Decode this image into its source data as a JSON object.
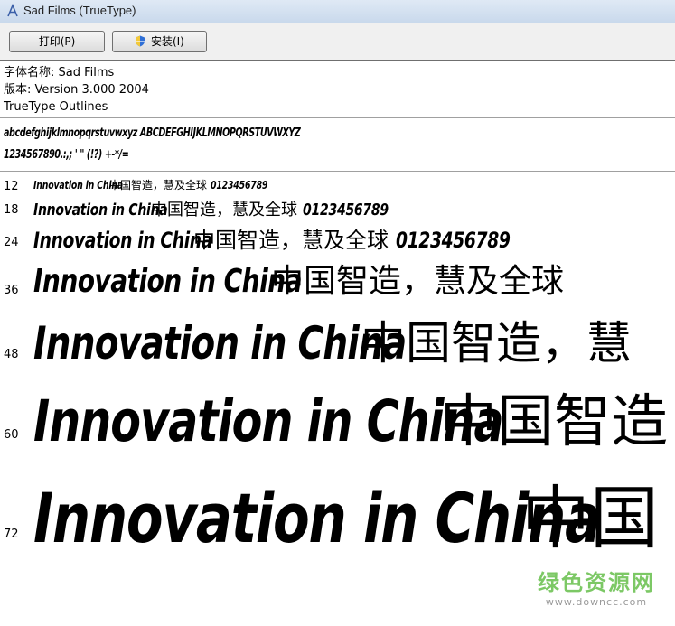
{
  "window": {
    "title": "Sad Films (TrueType)",
    "icon": "font-file-icon"
  },
  "toolbar": {
    "print_label": "打印(P)",
    "install_label": "安装(I)",
    "install_icon": "uac-shield-icon"
  },
  "font_info": {
    "name_line": "字体名称: Sad Films",
    "version_line": "版本: Version 3.000 2004",
    "outline_line": "TrueType Outlines"
  },
  "charset": {
    "line1": "abcdefghijklmnopqrstuvwxyz ABCDEFGHIJKLMNOPQRSTUVWXYZ",
    "line2": "1234567890.:,; ' \" (!?) +-*/="
  },
  "samples": [
    {
      "size": "12",
      "latin": "Innovation in China",
      "cjk": "中国智造，慧及全球",
      "digits": "0123456789"
    },
    {
      "size": "18",
      "latin": "Innovation in China",
      "cjk": "中国智造，慧及全球",
      "digits": "0123456789"
    },
    {
      "size": "24",
      "latin": "Innovation in China",
      "cjk": "中国智造，慧及全球",
      "digits": "0123456789"
    },
    {
      "size": "36",
      "latin": "Innovation in China",
      "cjk": "中国智造，慧及全球",
      "digits": ""
    },
    {
      "size": "48",
      "latin": "Innovation in China",
      "cjk": "中国智造，慧",
      "digits": ""
    },
    {
      "size": "60",
      "latin": "Innovation in China",
      "cjk": "中国智造",
      "digits": ""
    },
    {
      "size": "72",
      "latin": "Innovation in China",
      "cjk": "中国",
      "digits": ""
    }
  ],
  "watermark": {
    "main": "绿色资源网",
    "sub": "www.downcc.com"
  },
  "colors": {
    "watermark_green": "#7cc865",
    "toolbar_bg": "#f0f0f0"
  }
}
